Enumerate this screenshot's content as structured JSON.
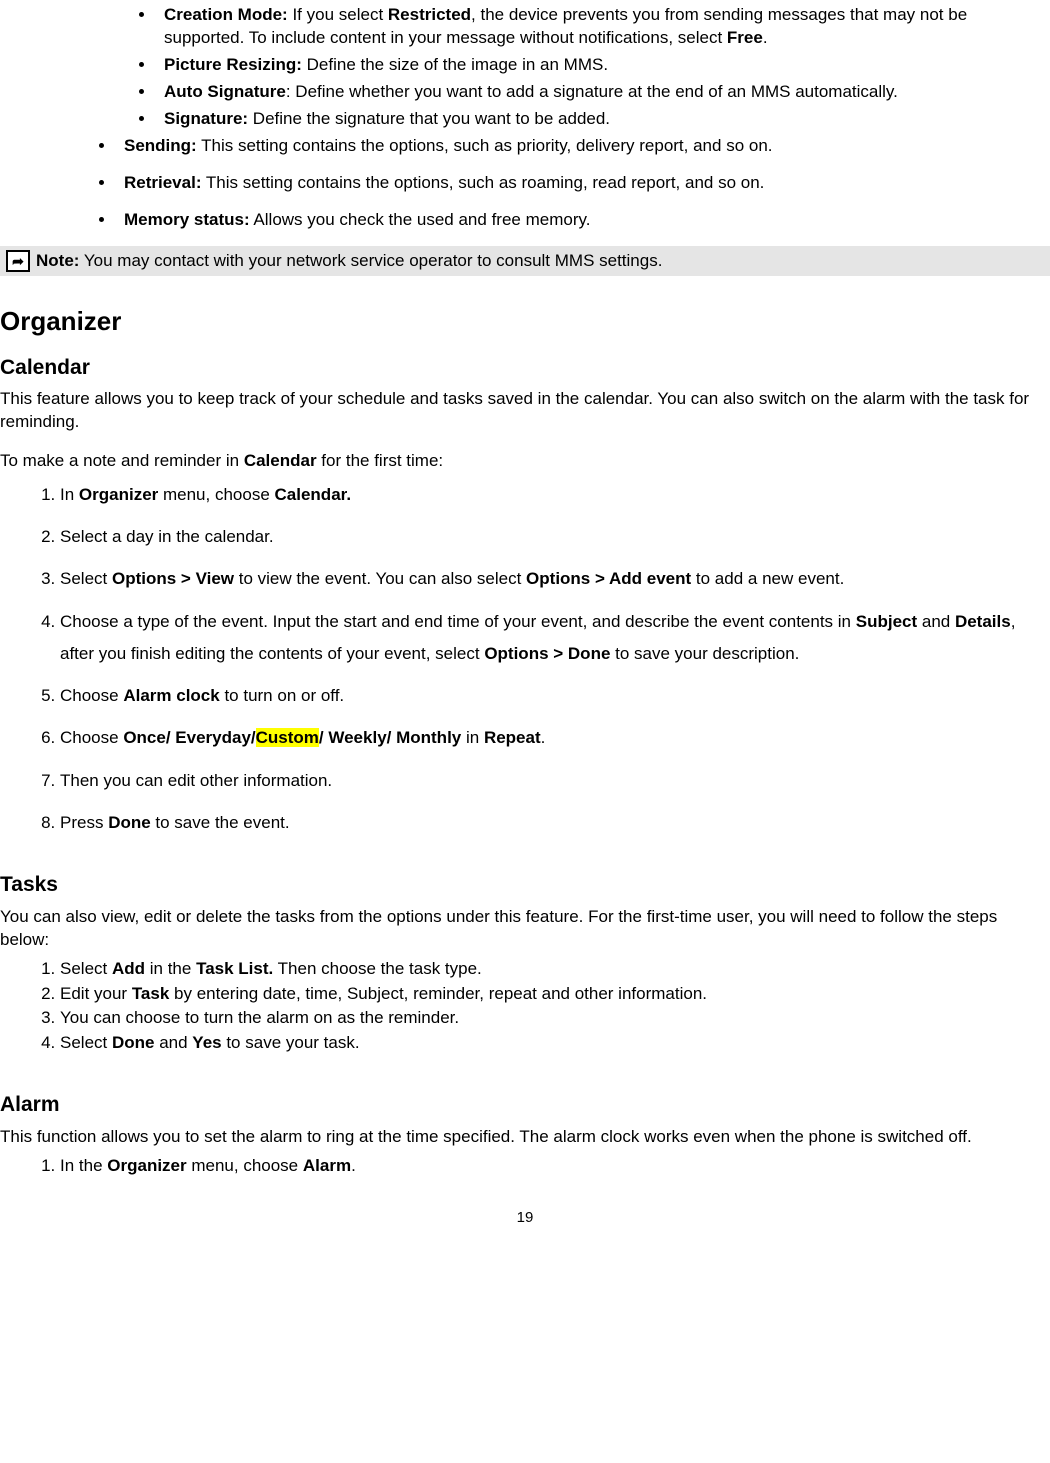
{
  "mms": {
    "items_inner": [
      {
        "label": "Creation Mode:",
        "text": " If you select ",
        "b1": "Restricted",
        "t2": ", the device prevents you from sending messages that may not be supported. To include content in your message without notifications, select ",
        "b2": "Free",
        "t3": "."
      },
      {
        "label": "Picture Resizing:",
        "text": " Define the size of the image in an MMS."
      },
      {
        "label": "Auto Signature",
        "text": ": Define whether you want to add a signature at the end of an MMS automatically."
      },
      {
        "label": "Signature:",
        "text": " Define the signature that you want to be added."
      }
    ],
    "items_outer": [
      {
        "label": "Sending:",
        "text": " This setting contains the options, such as priority, delivery report, and so on."
      },
      {
        "label": "Retrieval:",
        "text": " This setting contains the options, such as roaming, read report, and so on."
      },
      {
        "label": "Memory status:",
        "text": " Allows you check the used and free memory."
      }
    ]
  },
  "note": {
    "label": "Note:",
    "text": " You may contact with your network service operator to consult MMS settings."
  },
  "organizer": {
    "heading": "Organizer",
    "calendar": {
      "heading": "Calendar",
      "intro": "This feature allows you to keep track of your schedule and tasks saved in the calendar. You can also switch on the alarm with the task for reminding.",
      "lead": [
        "To make a note and reminder in ",
        "Calendar",
        " for the first time:"
      ],
      "steps": [
        {
          "parts": [
            [
              "t",
              "In "
            ],
            [
              "b",
              "Organizer"
            ],
            [
              "t",
              " menu, choose "
            ],
            [
              "b",
              "Calendar."
            ]
          ]
        },
        {
          "parts": [
            [
              "t",
              "Select a day in the calendar."
            ]
          ]
        },
        {
          "parts": [
            [
              "t",
              "Select "
            ],
            [
              "b",
              "Options > View"
            ],
            [
              "t",
              " to view the event. You can also select "
            ],
            [
              "b",
              "Options > Add event"
            ],
            [
              "t",
              " to add a new event."
            ]
          ]
        },
        {
          "parts": [
            [
              "t",
              "Choose a type of the event. Input the start and end time of your event, and describe the event contents in "
            ],
            [
              "b",
              "Subject"
            ],
            [
              "t",
              " and "
            ],
            [
              "b",
              "Details"
            ],
            [
              "t",
              ", after you finish editing the contents of your event, select "
            ],
            [
              "b",
              "Options > Done"
            ],
            [
              "t",
              " to save your description."
            ]
          ]
        },
        {
          "parts": [
            [
              "t",
              "Choose "
            ],
            [
              "b",
              "Alarm clock"
            ],
            [
              "t",
              " to turn on or off."
            ]
          ]
        },
        {
          "parts": [
            [
              "t",
              "Choose "
            ],
            [
              "b",
              "Once/ Everyday/"
            ],
            [
              "hl",
              "Custom"
            ],
            [
              "b",
              "/ Weekly/ Monthly"
            ],
            [
              "t",
              " in "
            ],
            [
              "b",
              "Repeat"
            ],
            [
              "t",
              "."
            ]
          ]
        },
        {
          "parts": [
            [
              "t",
              "Then you can edit other information."
            ]
          ]
        },
        {
          "parts": [
            [
              "t",
              "Press "
            ],
            [
              "b",
              "Done"
            ],
            [
              "t",
              " to save the event."
            ]
          ]
        }
      ]
    },
    "tasks": {
      "heading": "Tasks",
      "intro": "You can also view, edit or delete the tasks from the options under this feature. For the first-time user, you will need to follow the steps below:",
      "steps": [
        {
          "parts": [
            [
              "t",
              "Select "
            ],
            [
              "b",
              "Add"
            ],
            [
              "t",
              " in the "
            ],
            [
              "b",
              "Task List."
            ],
            [
              "t",
              " Then choose the task type."
            ]
          ]
        },
        {
          "parts": [
            [
              "t",
              "Edit your "
            ],
            [
              "b",
              "Task"
            ],
            [
              "t",
              " by entering date, time, Subject, reminder, repeat and other information."
            ]
          ]
        },
        {
          "parts": [
            [
              "t",
              "You can choose to turn the alarm on as the reminder."
            ]
          ]
        },
        {
          "parts": [
            [
              "t",
              "Select "
            ],
            [
              "b",
              "Done"
            ],
            [
              "t",
              " and "
            ],
            [
              "b",
              "Yes"
            ],
            [
              "t",
              " to save your task."
            ]
          ]
        }
      ]
    },
    "alarm": {
      "heading": "Alarm",
      "intro": "This function allows you to set the alarm to ring at the time specified. The alarm clock works even when the phone is switched off.",
      "steps": [
        {
          "parts": [
            [
              "t",
              "In the "
            ],
            [
              "b",
              "Organizer"
            ],
            [
              "t",
              " menu, choose "
            ],
            [
              "b",
              "Alarm"
            ],
            [
              "t",
              "."
            ]
          ]
        }
      ]
    }
  },
  "page_number": "19"
}
